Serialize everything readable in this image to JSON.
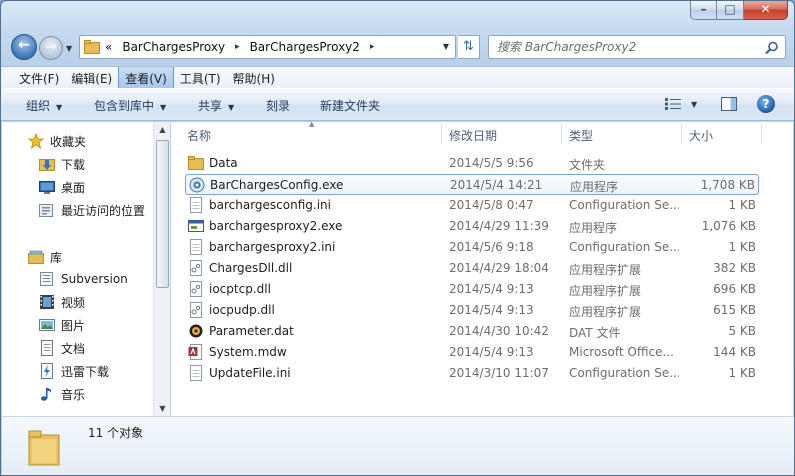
{
  "window": {
    "title": "",
    "minimize_glyph": "–",
    "maximize_glyph": "□",
    "close_glyph": "✕"
  },
  "address": {
    "overflow": "«",
    "crumbs": [
      "BarChargesProxy",
      "BarChargesProxy2"
    ],
    "sep": "▸"
  },
  "search": {
    "placeholder": "搜索 BarChargesProxy2"
  },
  "menu": {
    "items": [
      "文件(F)",
      "编辑(E)",
      "查看(V)",
      "工具(T)",
      "帮助(H)"
    ],
    "active_index": 2
  },
  "toolbar": {
    "organize": "组织",
    "include_library": "包含到库中",
    "share": "共享",
    "burn": "刻录",
    "new_folder": "新建文件夹",
    "help": "?"
  },
  "nav": {
    "favorites": "收藏夹",
    "downloads": "下载",
    "desktop": "桌面",
    "recent": "最近访问的位置",
    "libraries": "库",
    "subversion": "Subversion",
    "videos": "视频",
    "pictures": "图片",
    "documents": "文档",
    "thunder": "迅雷下载",
    "music": "音乐"
  },
  "columns": {
    "name": "名称",
    "date": "修改日期",
    "type": "类型",
    "size": "大小"
  },
  "files": [
    {
      "name": "Data",
      "date": "2014/5/5 9:56",
      "type": "文件夹",
      "size": "",
      "icon": "folder-icon"
    },
    {
      "name": "BarChargesConfig.exe",
      "date": "2014/5/4 14:21",
      "type": "应用程序",
      "size": "1,708 KB",
      "icon": "gear-exe-icon",
      "selected": true
    },
    {
      "name": "barchargesconfig.ini",
      "date": "2014/5/8 0:47",
      "type": "Configuration Se...",
      "size": "1 KB",
      "icon": "ini-file-icon"
    },
    {
      "name": "barchargesproxy2.exe",
      "date": "2014/4/29 11:39",
      "type": "应用程序",
      "size": "1,076 KB",
      "icon": "exe-window-icon"
    },
    {
      "name": "barchargesproxy2.ini",
      "date": "2014/5/6 9:18",
      "type": "Configuration Se...",
      "size": "1 KB",
      "icon": "ini-file-icon"
    },
    {
      "name": "ChargesDll.dll",
      "date": "2014/4/29 18:04",
      "type": "应用程序扩展",
      "size": "382 KB",
      "icon": "dll-file-icon"
    },
    {
      "name": "iocptcp.dll",
      "date": "2014/5/4 9:13",
      "type": "应用程序扩展",
      "size": "696 KB",
      "icon": "dll-file-icon"
    },
    {
      "name": "iocpudp.dll",
      "date": "2014/5/4 9:13",
      "type": "应用程序扩展",
      "size": "615 KB",
      "icon": "dll-file-icon"
    },
    {
      "name": "Parameter.dat",
      "date": "2014/4/30 10:42",
      "type": "DAT 文件",
      "size": "5 KB",
      "icon": "dat-file-icon"
    },
    {
      "name": "System.mdw",
      "date": "2014/5/4 9:13",
      "type": "Microsoft Office...",
      "size": "144 KB",
      "icon": "access-file-icon"
    },
    {
      "name": "UpdateFile.ini",
      "date": "2014/3/10 11:07",
      "type": "Configuration Se...",
      "size": "1 KB",
      "icon": "ini-file-icon"
    }
  ],
  "details": {
    "count": "11 个对象"
  },
  "colors": {
    "accent": "#3c77b7",
    "selection_border": "#7da2ce",
    "folder": "#e0b54a"
  }
}
